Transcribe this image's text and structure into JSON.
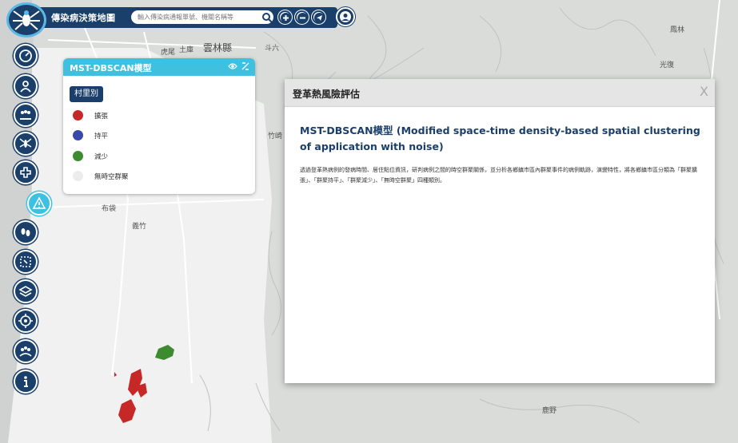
{
  "header": {
    "app_title": "傳染病決策地圖",
    "search_placeholder": "輸入傳染病通報單號、機關名稱等"
  },
  "toolbar_icons": [
    "search-icon",
    "zoom-in-icon",
    "zoom-out-icon",
    "locate-icon",
    "user-icon"
  ],
  "left_tools": [
    "dashboard-icon",
    "person-icon",
    "group-icon",
    "mosquito-icon",
    "medical-cross-icon",
    "dengue-risk-icon",
    "footprints-icon",
    "area-analysis-icon",
    "layers-icon",
    "target-icon",
    "community-icon",
    "info-icon"
  ],
  "map": {
    "labels": [
      "土庫",
      "雲林縣",
      "斗六",
      "虎尾",
      "布袋",
      "義竹",
      "竹崎",
      "鳳林",
      "光復",
      "鹿野"
    ]
  },
  "legend": {
    "title": "MST-DBSCAN模型",
    "unit_button": "村里別",
    "items": [
      {
        "label": "擴張",
        "color": "#c62828"
      },
      {
        "label": "持平",
        "color": "#3949ab"
      },
      {
        "label": "減少",
        "color": "#3d8b2f"
      },
      {
        "label": "無時空群聚",
        "color": "#ececec"
      }
    ]
  },
  "dialog": {
    "title": "登革熱風險評估",
    "close_label": "X",
    "heading": "MST-DBSCAN模型 (Modified space-time density-based spatial clustering of application with noise)",
    "body": "透過登革熱病例的發病時間、居住點位資訊，研判病例之間的時空群聚關係，並分析各鄉鎮市區內群聚事件的病例軌跡，演變特性，將各鄉鎮市區分類為「群聚擴張」、「群聚持平」、「群聚減少」、「無時空群聚」四種類別。"
  },
  "colors": {
    "navy": "#1a3f6b",
    "accent": "#3ec1e0",
    "expand": "#c62828",
    "stable": "#3949ab",
    "decrease": "#3d8b2f"
  }
}
